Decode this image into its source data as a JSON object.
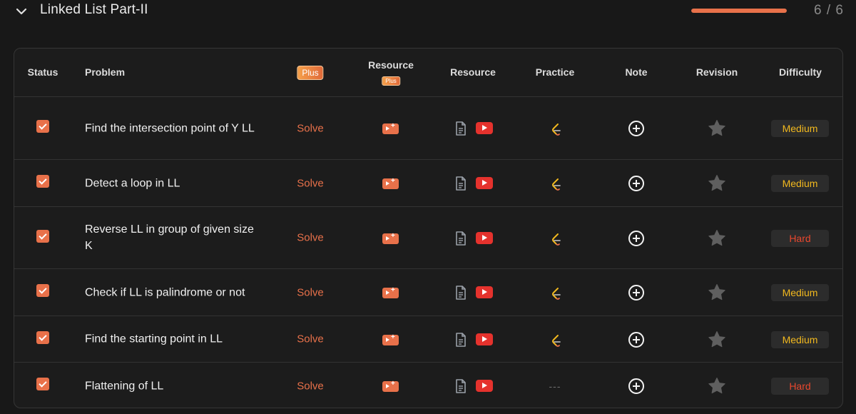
{
  "section": {
    "title": "Linked List Part-II",
    "progress_count": "6 / 6",
    "progress_fraction": 1.0
  },
  "columns": {
    "status": "Status",
    "problem": "Problem",
    "plus_badge": "Plus",
    "resource_plus": "Resource",
    "resource_plus_badge": "Plus",
    "resource": "Resource",
    "practice": "Practice",
    "note": "Note",
    "revision": "Revision",
    "difficulty": "Difficulty"
  },
  "rows": [
    {
      "problem": "Find the intersection point of Y LL",
      "solve": "Solve",
      "practice": "leetcode-icon",
      "difficulty": "Medium",
      "checked": true
    },
    {
      "problem": "Detect a loop in LL",
      "solve": "Solve",
      "practice": "leetcode-icon",
      "difficulty": "Medium",
      "checked": true
    },
    {
      "problem": "Reverse LL in group of given size K",
      "solve": "Solve",
      "practice": "leetcode-icon",
      "difficulty": "Hard",
      "checked": true
    },
    {
      "problem": "Check if LL is palindrome or not",
      "solve": "Solve",
      "practice": "leetcode-icon",
      "difficulty": "Medium",
      "checked": true
    },
    {
      "problem": "Find the starting point in LL",
      "solve": "Solve",
      "practice": "leetcode-icon",
      "difficulty": "Medium",
      "checked": true
    },
    {
      "problem": "Flattening of LL",
      "solve": "Solve",
      "practice_text": "---",
      "difficulty": "Hard",
      "checked": true
    }
  ],
  "colors": {
    "accent": "#e8714a",
    "medium": "#f2b91e",
    "hard": "#e8472e",
    "youtube": "#e5322d"
  }
}
